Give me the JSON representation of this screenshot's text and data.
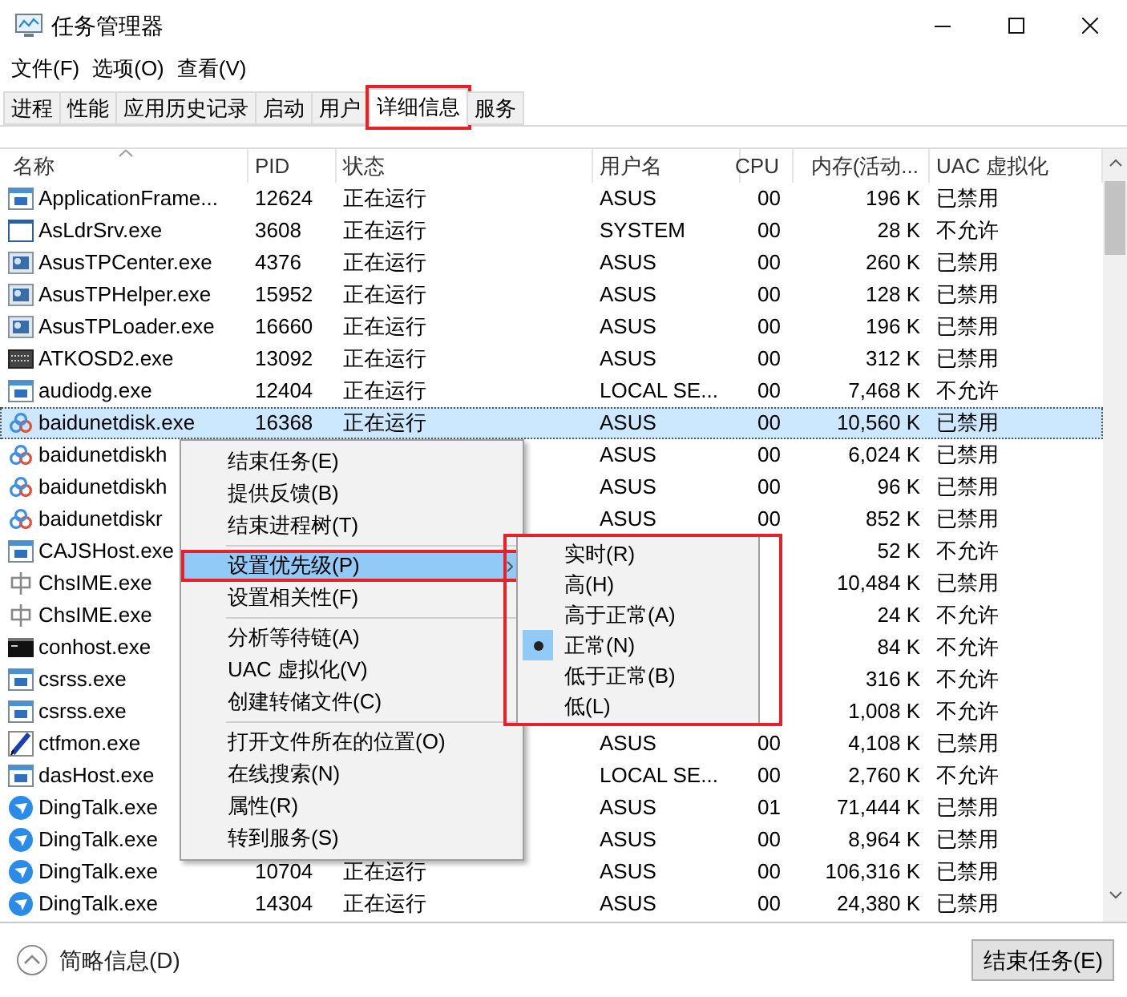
{
  "window": {
    "title": "任务管理器"
  },
  "menu_bar": [
    "文件(F)",
    "选项(O)",
    "查看(V)"
  ],
  "tabs": [
    {
      "label": "进程",
      "selected": false,
      "annotated": false
    },
    {
      "label": "性能",
      "selected": false,
      "annotated": false
    },
    {
      "label": "应用历史记录",
      "selected": false,
      "annotated": false
    },
    {
      "label": "启动",
      "selected": false,
      "annotated": false
    },
    {
      "label": "用户",
      "selected": false,
      "annotated": false
    },
    {
      "label": "详细信息",
      "selected": true,
      "annotated": true
    },
    {
      "label": "服务",
      "selected": false,
      "annotated": false
    }
  ],
  "table": {
    "columns": [
      "名称",
      "PID",
      "状态",
      "用户名",
      "CPU",
      "内存(活动...",
      "UAC 虚拟化"
    ],
    "rows": [
      {
        "kind": "window",
        "selected": false,
        "name": "ApplicationFrame...",
        "pid": "12624",
        "status": "正在运行",
        "user": "ASUS",
        "cpu": "00",
        "memory": "196 K",
        "uac": "已禁用"
      },
      {
        "kind": "blank",
        "selected": false,
        "name": "AsLdrSrv.exe",
        "pid": "3608",
        "status": "正在运行",
        "user": "SYSTEM",
        "cpu": "00",
        "memory": "28 K",
        "uac": "不允许"
      },
      {
        "kind": "asus",
        "selected": false,
        "name": "AsusTPCenter.exe",
        "pid": "4376",
        "status": "正在运行",
        "user": "ASUS",
        "cpu": "00",
        "memory": "260 K",
        "uac": "已禁用"
      },
      {
        "kind": "asus",
        "selected": false,
        "name": "AsusTPHelper.exe",
        "pid": "15952",
        "status": "正在运行",
        "user": "ASUS",
        "cpu": "00",
        "memory": "128 K",
        "uac": "已禁用"
      },
      {
        "kind": "asus",
        "selected": false,
        "name": "AsusTPLoader.exe",
        "pid": "16660",
        "status": "正在运行",
        "user": "ASUS",
        "cpu": "00",
        "memory": "196 K",
        "uac": "已禁用"
      },
      {
        "kind": "osd",
        "selected": false,
        "name": "ATKOSD2.exe",
        "pid": "13092",
        "status": "正在运行",
        "user": "ASUS",
        "cpu": "00",
        "memory": "312 K",
        "uac": "已禁用"
      },
      {
        "kind": "window",
        "selected": false,
        "name": "audiodg.exe",
        "pid": "12404",
        "status": "正在运行",
        "user": "LOCAL SE...",
        "cpu": "00",
        "memory": "7,468 K",
        "uac": "不允许"
      },
      {
        "kind": "cloud",
        "selected": true,
        "name": "baidunetdisk.exe",
        "pid": "16368",
        "status": "正在运行",
        "user": "ASUS",
        "cpu": "00",
        "memory": "10,560 K",
        "uac": "已禁用"
      },
      {
        "kind": "cloud",
        "selected": false,
        "name": "baidunetdiskh",
        "user": "ASUS",
        "cpu": "00",
        "memory": "6,024 K",
        "uac": "已禁用"
      },
      {
        "kind": "cloud",
        "selected": false,
        "name": "baidunetdiskh",
        "user": "ASUS",
        "cpu": "00",
        "memory": "96 K",
        "uac": "已禁用"
      },
      {
        "kind": "cloud",
        "selected": false,
        "name": "baidunetdiskr",
        "user": "ASUS",
        "cpu": "00",
        "memory": "852 K",
        "uac": "已禁用"
      },
      {
        "kind": "window",
        "selected": false,
        "name": "CAJSHost.exe",
        "memory": "52 K",
        "uac": "不允许"
      },
      {
        "kind": "chs",
        "selected": false,
        "name": "ChsIME.exe",
        "memory": "10,484 K",
        "uac": "已禁用"
      },
      {
        "kind": "chs",
        "selected": false,
        "name": "ChsIME.exe",
        "memory": "24 K",
        "uac": "不允许"
      },
      {
        "kind": "console",
        "selected": false,
        "name": "conhost.exe",
        "memory": "84 K",
        "uac": "不允许"
      },
      {
        "kind": "window",
        "selected": false,
        "name": "csrss.exe",
        "memory": "316 K",
        "uac": "不允许"
      },
      {
        "kind": "window",
        "selected": false,
        "name": "csrss.exe",
        "memory": "1,008 K",
        "uac": "不允许"
      },
      {
        "kind": "pen",
        "selected": false,
        "name": "ctfmon.exe",
        "user": "ASUS",
        "cpu": "00",
        "memory": "4,108 K",
        "uac": "已禁用"
      },
      {
        "kind": "window",
        "selected": false,
        "name": "dasHost.exe",
        "user": "LOCAL SE...",
        "cpu": "00",
        "memory": "2,760 K",
        "uac": "不允许"
      },
      {
        "kind": "ding",
        "selected": false,
        "name": "DingTalk.exe",
        "user": "ASUS",
        "cpu": "01",
        "memory": "71,444 K",
        "uac": "已禁用"
      },
      {
        "kind": "ding",
        "selected": false,
        "name": "DingTalk.exe",
        "user": "ASUS",
        "cpu": "00",
        "memory": "8,964 K",
        "uac": "已禁用"
      },
      {
        "kind": "ding",
        "selected": false,
        "name": "DingTalk.exe",
        "pid": "10704",
        "status": "正在运行",
        "user": "ASUS",
        "cpu": "00",
        "memory": "106,316 K",
        "uac": "已禁用"
      },
      {
        "kind": "ding",
        "selected": false,
        "name": "DingTalk.exe",
        "pid": "14304",
        "status": "正在运行",
        "user": "ASUS",
        "cpu": "00",
        "memory": "24,380 K",
        "uac": "已禁用"
      }
    ]
  },
  "context_menu": {
    "groups": [
      [
        {
          "label": "结束任务(E)",
          "selected": false,
          "has_submenu": false,
          "annotated": false
        },
        {
          "label": "提供反馈(B)",
          "selected": false,
          "has_submenu": false,
          "annotated": false
        },
        {
          "label": "结束进程树(T)",
          "selected": false,
          "has_submenu": false,
          "annotated": false
        }
      ],
      [
        {
          "label": "设置优先级(P)",
          "selected": true,
          "has_submenu": true,
          "annotated": true
        },
        {
          "label": "设置相关性(F)",
          "selected": false,
          "has_submenu": false,
          "annotated": false
        }
      ],
      [
        {
          "label": "分析等待链(A)",
          "selected": false,
          "has_submenu": false,
          "annotated": false
        },
        {
          "label": "UAC 虚拟化(V)",
          "selected": false,
          "has_submenu": false,
          "annotated": false
        },
        {
          "label": "创建转储文件(C)",
          "selected": false,
          "has_submenu": false,
          "annotated": false
        }
      ],
      [
        {
          "label": "打开文件所在的位置(O)",
          "selected": false,
          "has_submenu": false,
          "annotated": false
        },
        {
          "label": "在线搜索(N)",
          "selected": false,
          "has_submenu": false,
          "annotated": false
        },
        {
          "label": "属性(R)",
          "selected": false,
          "has_submenu": false,
          "annotated": false
        },
        {
          "label": "转到服务(S)",
          "selected": false,
          "has_submenu": false,
          "annotated": false
        }
      ]
    ]
  },
  "priority_submenu": {
    "annotated": true,
    "items": [
      {
        "label": "实时(R)",
        "checked": false
      },
      {
        "label": "高(H)",
        "checked": false
      },
      {
        "label": "高于正常(A)",
        "checked": false
      },
      {
        "label": "正常(N)",
        "checked": true
      },
      {
        "label": "低于正常(B)",
        "checked": false
      },
      {
        "label": "低(L)",
        "checked": false
      }
    ]
  },
  "footer": {
    "toggle_label": "简略信息(D)",
    "end_task_button": "结束任务(E)"
  }
}
